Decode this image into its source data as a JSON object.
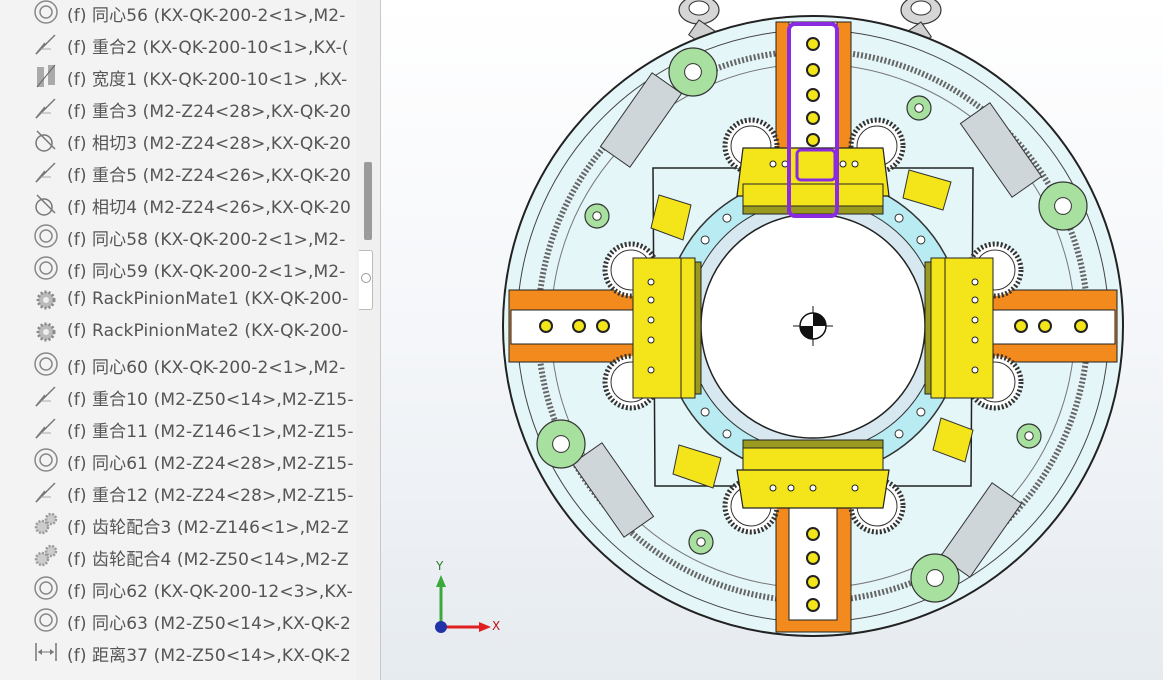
{
  "feature_tree": {
    "items": [
      {
        "icon": "concentric-icon",
        "label": "(f) 同心56 (KX-QK-200-2<1>,M2-"
      },
      {
        "icon": "coincident-icon",
        "label": "(f) 重合2 (KX-QK-200-10<1>,KX-("
      },
      {
        "icon": "width-icon",
        "label": "(f) 宽度1 (KX-QK-200-10<1> ,KX-"
      },
      {
        "icon": "coincident-icon",
        "label": "(f) 重合3 (M2-Z24<28>,KX-QK-20"
      },
      {
        "icon": "tangent-icon",
        "label": "(f) 相切3 (M2-Z24<28>,KX-QK-20"
      },
      {
        "icon": "coincident-icon",
        "label": "(f) 重合5 (M2-Z24<26>,KX-QK-20"
      },
      {
        "icon": "tangent-icon",
        "label": "(f) 相切4 (M2-Z24<26>,KX-QK-20"
      },
      {
        "icon": "concentric-icon",
        "label": "(f) 同心58 (KX-QK-200-2<1>,M2-"
      },
      {
        "icon": "concentric-icon",
        "label": "(f) 同心59 (KX-QK-200-2<1>,M2-"
      },
      {
        "icon": "rack-pinion-icon",
        "label": "(f) RackPinionMate1 (KX-QK-200-"
      },
      {
        "icon": "rack-pinion-icon",
        "label": "(f) RackPinionMate2 (KX-QK-200-"
      },
      {
        "icon": "concentric-icon",
        "label": "(f) 同心60 (KX-QK-200-2<1>,M2-"
      },
      {
        "icon": "coincident-icon",
        "label": "(f) 重合10 (M2-Z50<14>,M2-Z15-"
      },
      {
        "icon": "coincident-icon",
        "label": "(f) 重合11 (M2-Z146<1>,M2-Z15-"
      },
      {
        "icon": "concentric-icon",
        "label": "(f) 同心61 (M2-Z24<28>,M2-Z15-"
      },
      {
        "icon": "coincident-icon",
        "label": "(f) 重合12 (M2-Z24<28>,M2-Z15-"
      },
      {
        "icon": "gear-mate-icon",
        "label": "(f) 齿轮配合3 (M2-Z146<1>,M2-Z"
      },
      {
        "icon": "gear-mate-icon",
        "label": "(f) 齿轮配合4 (M2-Z50<14>,M2-Z"
      },
      {
        "icon": "concentric-icon",
        "label": "(f) 同心62 (KX-QK-200-12<3>,KX-"
      },
      {
        "icon": "concentric-icon",
        "label": "(f) 同心63 (M2-Z50<14>,KX-QK-2"
      },
      {
        "icon": "distance-icon",
        "label": "(f) 距离37 (M2-Z50<14>,KX-QK-2"
      }
    ]
  },
  "triad": {
    "y_label": "Y",
    "x_label": "X"
  },
  "colors": {
    "rack_orange": "#f28a1e",
    "jaw_yellow": "#f4e51a",
    "gear_green": "#a8e0a0",
    "ring_cyan": "#b9ecf2",
    "selection_purple": "#8a2be2",
    "plate": "#e4f6f8"
  }
}
